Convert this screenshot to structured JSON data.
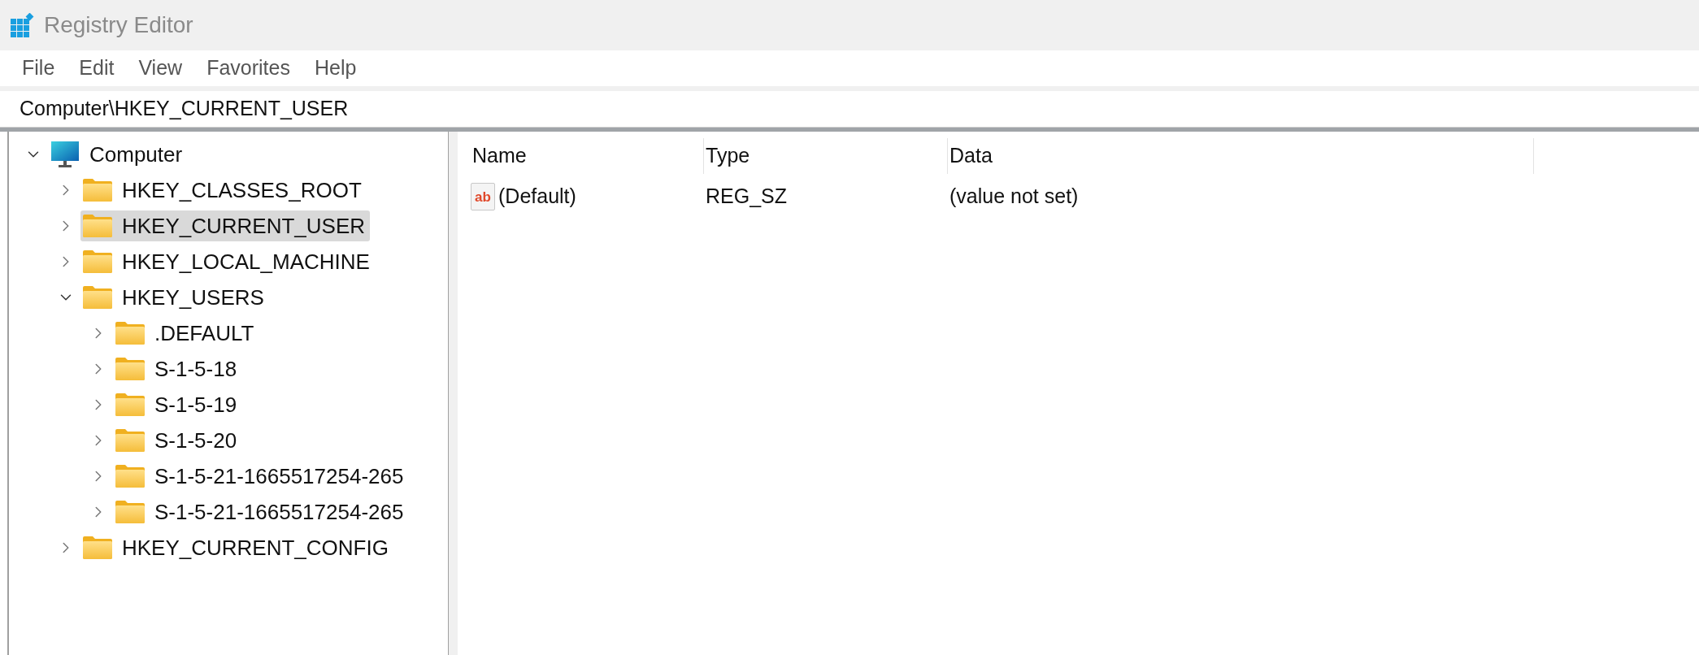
{
  "window": {
    "title": "Registry Editor"
  },
  "menu": [
    "File",
    "Edit",
    "View",
    "Favorites",
    "Help"
  ],
  "address": "Computer\\HKEY_CURRENT_USER",
  "tree": {
    "label": "Computer",
    "kind": "computer",
    "expanded": true,
    "selected": false,
    "children": [
      {
        "label": "HKEY_CLASSES_ROOT",
        "kind": "folder",
        "expanded": false,
        "selected": false
      },
      {
        "label": "HKEY_CURRENT_USER",
        "kind": "folder",
        "expanded": false,
        "selected": true
      },
      {
        "label": "HKEY_LOCAL_MACHINE",
        "kind": "folder",
        "expanded": false,
        "selected": false
      },
      {
        "label": "HKEY_USERS",
        "kind": "folder",
        "expanded": true,
        "selected": false,
        "children": [
          {
            "label": ".DEFAULT",
            "kind": "folder",
            "expanded": false,
            "selected": false
          },
          {
            "label": "S-1-5-18",
            "kind": "folder",
            "expanded": false,
            "selected": false
          },
          {
            "label": "S-1-5-19",
            "kind": "folder",
            "expanded": false,
            "selected": false
          },
          {
            "label": "S-1-5-20",
            "kind": "folder",
            "expanded": false,
            "selected": false
          },
          {
            "label": "S-1-5-21-1665517254-265",
            "kind": "folder",
            "expanded": false,
            "selected": false
          },
          {
            "label": "S-1-5-21-1665517254-265",
            "kind": "folder",
            "expanded": false,
            "selected": false
          }
        ]
      },
      {
        "label": "HKEY_CURRENT_CONFIG",
        "kind": "folder",
        "expanded": false,
        "selected": false
      }
    ]
  },
  "list": {
    "columns": [
      "Name",
      "Type",
      "Data"
    ],
    "rows": [
      {
        "icon_label": "ab",
        "name": "(Default)",
        "type": "REG_SZ",
        "data": "(value not set)"
      }
    ]
  }
}
